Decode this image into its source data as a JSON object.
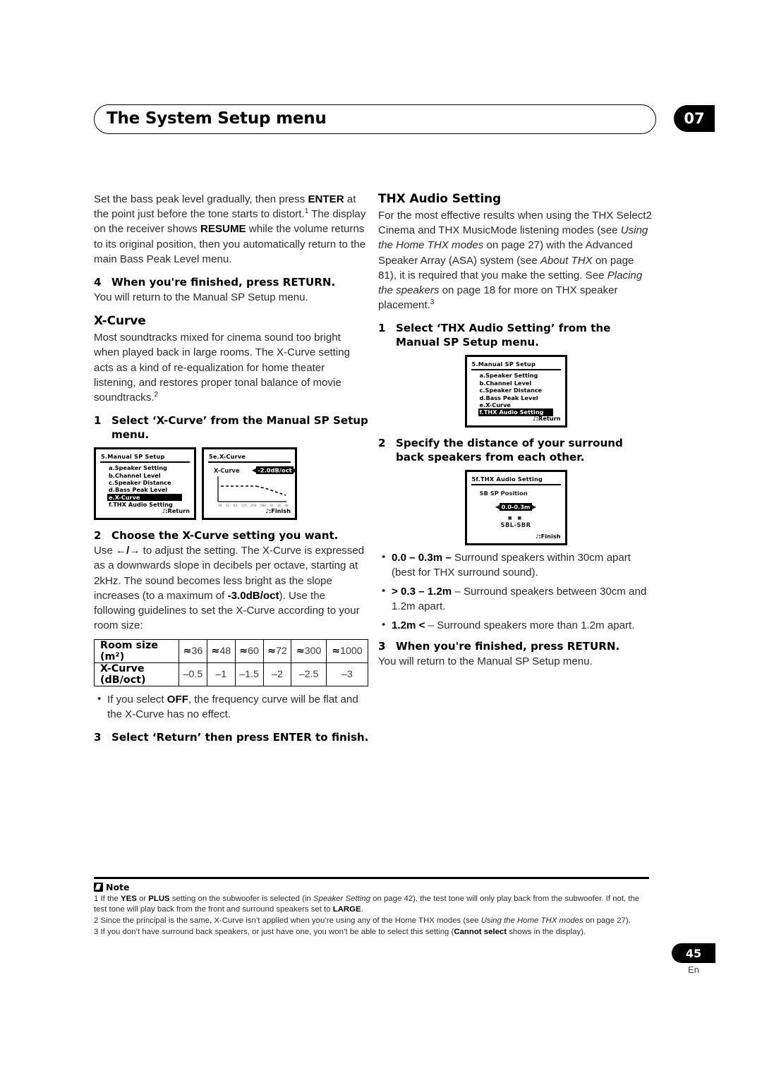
{
  "header": {
    "title": "The System Setup menu",
    "chapter": "07"
  },
  "left_column": {
    "intro_paragraph": {
      "p1": "Set the bass peak level gradually, then press ",
      "b1": "ENTER",
      "p2": " at the point just before the tone starts to distort.",
      "sup1": "1",
      "p3": " The display on the receiver shows ",
      "b2": "RESUME",
      "p4": " while the volume returns to its original position, then you automatically return to the main Bass Peak Level menu."
    },
    "step4": {
      "num": "4",
      "title": "When you're finished, press RETURN.",
      "sub": "You will return to the Manual SP Setup menu."
    },
    "xcurve": {
      "heading": "X-Curve",
      "body_p1": "Most soundtracks mixed for cinema sound too bright when played back in large rooms. The X-Curve setting acts as a kind of re-equalization for home theater listening, and restores proper tonal balance of movie soundtracks.",
      "body_sup": "2",
      "step1": {
        "num": "1",
        "title": "Select ‘X-Curve’ from the Manual SP Setup menu."
      },
      "step2": {
        "num": "2",
        "title": "Choose the X-Curve setting you want.",
        "sub_p1": "Use ",
        "sub_arrows": "←/→",
        "sub_p2": " to adjust the setting. The X-Curve is expressed as a downwards slope in decibels per octave, starting at 2kHz. The sound becomes less bright as the slope increases (to a maximum of ",
        "sub_b": "-3.0dB/oct",
        "sub_p3": "). Use the following guidelines to set the X-Curve according to your room size:"
      },
      "bullet_off": {
        "p1": "If you select ",
        "b1": "OFF",
        "p2": ", the frequency curve will be flat and the X-Curve has no effect."
      },
      "step3": {
        "num": "3",
        "title": "Select ‘Return’ then press ENTER to finish."
      }
    },
    "table": {
      "row1_header": "Room size (m²)",
      "row1_approx": "≈",
      "row1_values": [
        "36",
        "48",
        "60",
        "72",
        "300",
        "1000"
      ],
      "row2_header": "X-Curve (dB/oct)",
      "row2_values": [
        "–0.5",
        "–1",
        "–1.5",
        "–2",
        "–2.5",
        "–3"
      ]
    },
    "lcd_manual_sp": {
      "title": "5.Manual SP Setup",
      "items": [
        "a.Speaker  Setting",
        "b.Channel  Level",
        "c.Speaker  Distance",
        "d.Bass  Peak  Level",
        "e.X-Curve",
        "f.THX  Audio  Setting"
      ],
      "highlight_index": 4,
      "footer": ":Return"
    },
    "lcd_xcurve": {
      "title": "5e.X-Curve",
      "label": "X-Curve",
      "value": "-2.0dB/oct",
      "left_arrow": "◀",
      "right_arrow": "▶",
      "ticks": [
        "16",
        "31",
        "63",
        "125",
        "250",
        "500",
        "1k",
        "2k",
        "4k"
      ],
      "footer": ":Finish"
    }
  },
  "right_column": {
    "thx": {
      "heading": "THX Audio Setting",
      "body": {
        "t1": "For the most effective results when using the THX Select2 Cinema and THX MusicMode listening modes (see ",
        "i1": "Using the Home THX modes",
        "t2": " on page 27) with the Advanced Speaker Array (ASA) system (see ",
        "i2": "About THX",
        "t3": " on page 81), it is required that you make the setting. See ",
        "i3": "Placing the speakers",
        "t4": " on page 18 for more on THX speaker placement.",
        "sup": "3"
      },
      "step1": {
        "num": "1",
        "title": "Select ‘THX Audio Setting’ from the Manual SP Setup menu."
      },
      "step2": {
        "num": "2",
        "title": "Specify the distance of your surround back speakers from each other."
      },
      "bullets": [
        {
          "b": "0.0 – 0.3m –",
          "t": " Surround speakers within 30cm apart (best for THX surround sound)."
        },
        {
          "b": "> 0.3 – 1.2m",
          "t": " – Surround speakers between 30cm and 1.2m apart."
        },
        {
          "b": "1.2m <",
          "t": " – Surround speakers more than 1.2m apart."
        }
      ],
      "step3": {
        "num": "3",
        "title": "When you're finished, press RETURN.",
        "sub": "You will return to the Manual SP Setup menu."
      }
    },
    "lcd_manual_sp": {
      "title": "5.Manual SP Setup",
      "items": [
        "a.Speaker  Setting",
        "b.Channel  Level",
        "c.Speaker  Distance",
        "d.Bass  Peak  Level",
        "e.X-Curve",
        "f.THX  Audio  Setting"
      ],
      "highlight_index": 5,
      "footer": ":Return"
    },
    "lcd_sb_position": {
      "title": "5f.THX  Audio  Setting",
      "label": "SB  SP  Position",
      "value": "0.0-0.3m",
      "left_arrow": "◀",
      "right_arrow": "▶",
      "speakers_icons": "■ ■",
      "speaker_name": "SBL-SBR",
      "footer": ":Finish"
    }
  },
  "notes": {
    "title": "Note",
    "items": [
      {
        "t1": "1 If the ",
        "b1": "YES",
        "t2": " or ",
        "b2": "PLUS",
        "t3": " setting on the subwoofer is selected (in ",
        "i1": "Speaker Setting",
        "t4": " on page 42), the test tone will only play back from the subwoofer. If not, the test tone will play back from the front and surround speakers set to ",
        "b3": "LARGE",
        "t5": "."
      },
      {
        "t1": "2 Since the principal is the same, X-Curve isn’t applied when you’re using any of the Home THX modes (see ",
        "i1": "Using the Home THX modes",
        "t2": " on page 27)."
      },
      {
        "t1": "3 If you don’t have surround back speakers, or just have one, you won’t be able to select this setting (",
        "b1": "Cannot select",
        "t2": " shows in the display)."
      }
    ]
  },
  "footer": {
    "page_number": "45",
    "language": "En"
  }
}
